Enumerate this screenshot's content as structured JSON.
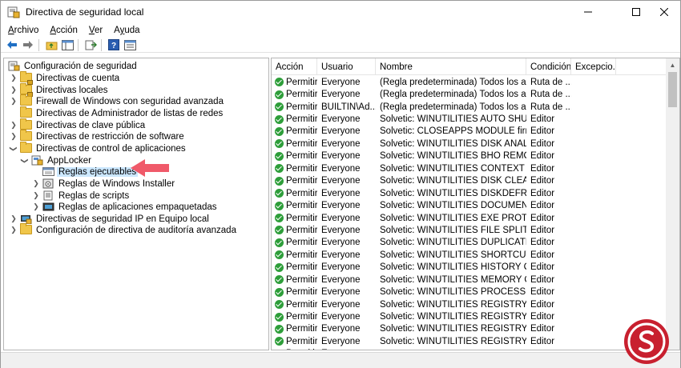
{
  "window": {
    "title": "Directiva de seguridad local",
    "controls": [
      "minimize",
      "maximize",
      "close"
    ]
  },
  "menubar": {
    "items": [
      {
        "label": "Archivo",
        "underline": "A"
      },
      {
        "label": "Acción",
        "underline": "A"
      },
      {
        "label": "Ver",
        "underline": "V"
      },
      {
        "label": "Ayuda",
        "underline": "y"
      }
    ]
  },
  "toolbar": {
    "icons": [
      "back-arrow-icon",
      "forward-arrow-icon",
      "up-folder-icon",
      "show-hide-tree-icon",
      "export-list-icon",
      "help-icon",
      "properties-icon"
    ]
  },
  "tree": {
    "root": "Configuración de seguridad",
    "items": [
      {
        "label": "Directivas de cuenta",
        "level": 1,
        "expander": "collapsed",
        "icon": "folder-lock-icon"
      },
      {
        "label": "Directivas locales",
        "level": 1,
        "expander": "collapsed",
        "icon": "folder-lock-icon"
      },
      {
        "label": "Firewall de Windows con seguridad avanzada",
        "level": 1,
        "expander": "collapsed",
        "icon": "folder-icon"
      },
      {
        "label": "Directivas de Administrador de listas de redes",
        "level": 1,
        "expander": "none",
        "icon": "folder-icon"
      },
      {
        "label": "Directivas de clave pública",
        "level": 1,
        "expander": "collapsed",
        "icon": "folder-icon"
      },
      {
        "label": "Directivas de restricción de software",
        "level": 1,
        "expander": "collapsed",
        "icon": "folder-icon"
      },
      {
        "label": "Directivas de control de aplicaciones",
        "level": 1,
        "expander": "expanded",
        "icon": "folder-icon"
      },
      {
        "label": "AppLocker",
        "level": 2,
        "expander": "expanded",
        "icon": "applocker-icon"
      },
      {
        "label": "Reglas ejecutables",
        "level": 3,
        "expander": "none",
        "icon": "rules-icon",
        "selected": true
      },
      {
        "label": "Reglas de Windows Installer",
        "level": 3,
        "expander": "collapsed",
        "icon": "installer-icon"
      },
      {
        "label": "Reglas de scripts",
        "level": 3,
        "expander": "collapsed",
        "icon": "script-icon"
      },
      {
        "label": "Reglas de aplicaciones empaquetadas",
        "level": 3,
        "expander": "collapsed",
        "icon": "package-icon"
      },
      {
        "label": "Directivas de seguridad IP en Equipo local",
        "level": 1,
        "expander": "collapsed",
        "icon": "ip-security-icon"
      },
      {
        "label": "Configuración de directiva de auditoría avanzada",
        "level": 1,
        "expander": "collapsed",
        "icon": "folder-icon"
      }
    ]
  },
  "list": {
    "columns": [
      "Acción",
      "Usuario",
      "Nombre",
      "Condición",
      "Excepcio..."
    ],
    "rows": [
      [
        "Permitir",
        "Everyone",
        "(Regla predeterminada) Todos los archi...",
        "Ruta de ...",
        ""
      ],
      [
        "Permitir",
        "Everyone",
        "(Regla predeterminada) Todos los archi...",
        "Ruta de ...",
        ""
      ],
      [
        "Permitir",
        "BUILTIN\\Ad...",
        "(Regla predeterminada) Todos los archi...",
        "Ruta de ...",
        ""
      ],
      [
        "Permitir",
        "Everyone",
        "Solvetic: WINUTILITIES AUTO SHUTDO...",
        "Editor",
        ""
      ],
      [
        "Permitir",
        "Everyone",
        "Solvetic: CLOSEAPPS MODULE firmado ...",
        "Editor",
        ""
      ],
      [
        "Permitir",
        "Everyone",
        "Solvetic: WINUTILITIES DISK ANALYSIS f...",
        "Editor",
        ""
      ],
      [
        "Permitir",
        "Everyone",
        "Solvetic: WINUTILITIES BHO REMOVER ...",
        "Editor",
        ""
      ],
      [
        "Permitir",
        "Everyone",
        "Solvetic: WINUTILITIES CONTEXT MEN...",
        "Editor",
        ""
      ],
      [
        "Permitir",
        "Everyone",
        "Solvetic: WINUTILITIES DISK CLEANER fi...",
        "Editor",
        ""
      ],
      [
        "Permitir",
        "Everyone",
        "Solvetic: WINUTILITIES DISKDEFRAG fir...",
        "Editor",
        ""
      ],
      [
        "Permitir",
        "Everyone",
        "Solvetic: WINUTILITIES DOCUMENT PR...",
        "Editor",
        ""
      ],
      [
        "Permitir",
        "Everyone",
        "Solvetic: WINUTILITIES EXE PROTECT fi...",
        "Editor",
        ""
      ],
      [
        "Permitir",
        "Everyone",
        "Solvetic: WINUTILITIES FILE SPLITTER fi...",
        "Editor",
        ""
      ],
      [
        "Permitir",
        "Everyone",
        "Solvetic: WINUTILITIES DUPLICATE FILE...",
        "Editor",
        ""
      ],
      [
        "Permitir",
        "Everyone",
        "Solvetic: WINUTILITIES SHORTCUTS FIX...",
        "Editor",
        ""
      ],
      [
        "Permitir",
        "Everyone",
        "Solvetic: WINUTILITIES HISTORY CLEAN...",
        "Editor",
        ""
      ],
      [
        "Permitir",
        "Everyone",
        "Solvetic: WINUTILITIES MEMORY OPTI...",
        "Editor",
        ""
      ],
      [
        "Permitir",
        "Everyone",
        "Solvetic: WINUTILITIES PROCESS SECUR...",
        "Editor",
        ""
      ],
      [
        "Permitir",
        "Everyone",
        "Solvetic: WINUTILITIES REGISTRY BACK...",
        "Editor",
        ""
      ],
      [
        "Permitir",
        "Everyone",
        "Solvetic: WINUTILITIES REGISTRYDEFRA...",
        "Editor",
        ""
      ],
      [
        "Permitir",
        "Everyone",
        "Solvetic: WINUTILITIES REGISTRY CLEA...",
        "Editor",
        ""
      ],
      [
        "Permitir",
        "Everyone",
        "Solvetic: WINUTILITIES REGISTRY SEAR...",
        "Editor",
        ""
      ],
      [
        "Permitir",
        "Everyone",
        "",
        "",
        ""
      ]
    ]
  },
  "colors": {
    "selection": "#cce8ff",
    "annotation_arrow": "#f05a6a",
    "check_green": "#2e9e3a",
    "watermark": "#c8202f"
  }
}
